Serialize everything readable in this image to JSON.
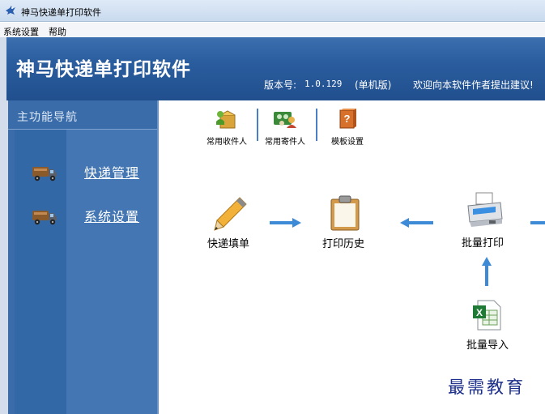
{
  "window": {
    "title": "神马快递单打印软件",
    "icon": "app-bird-icon"
  },
  "menu": {
    "items": [
      {
        "label": "系统设置"
      },
      {
        "label": "帮助"
      }
    ]
  },
  "banner": {
    "title": "神马快递单打印软件",
    "version_label": "版本号:",
    "version_value": "1.0.129",
    "edition": "(单机版)",
    "feedback": "欢迎向本软件作者提出建议!"
  },
  "sidebar": {
    "title": "主功能导航",
    "items": [
      {
        "label": "快递管理",
        "icon": "truck-icon"
      },
      {
        "label": "系统设置",
        "icon": "truck-icon"
      }
    ]
  },
  "toolbar": {
    "items": [
      {
        "label": "常用收件人",
        "icon": "recipient-icon"
      },
      {
        "label": "常用寄件人",
        "icon": "sender-icon"
      },
      {
        "label": "模板设置",
        "icon": "template-icon"
      }
    ]
  },
  "flow": {
    "fill": {
      "label": "快递填单",
      "icon": "pencil-icon"
    },
    "history": {
      "label": "打印历史",
      "icon": "clipboard-icon"
    },
    "batch_print": {
      "label": "批量打印",
      "icon": "printer-icon"
    },
    "batch_import": {
      "label": "批量导入",
      "icon": "excel-icon"
    }
  },
  "watermark": "最需教育",
  "colors": {
    "banner": "#2a5d9e",
    "sidebar": "#3a6ca9",
    "arrow": "#3d8bd6",
    "watermark": "#1c2f8a"
  }
}
